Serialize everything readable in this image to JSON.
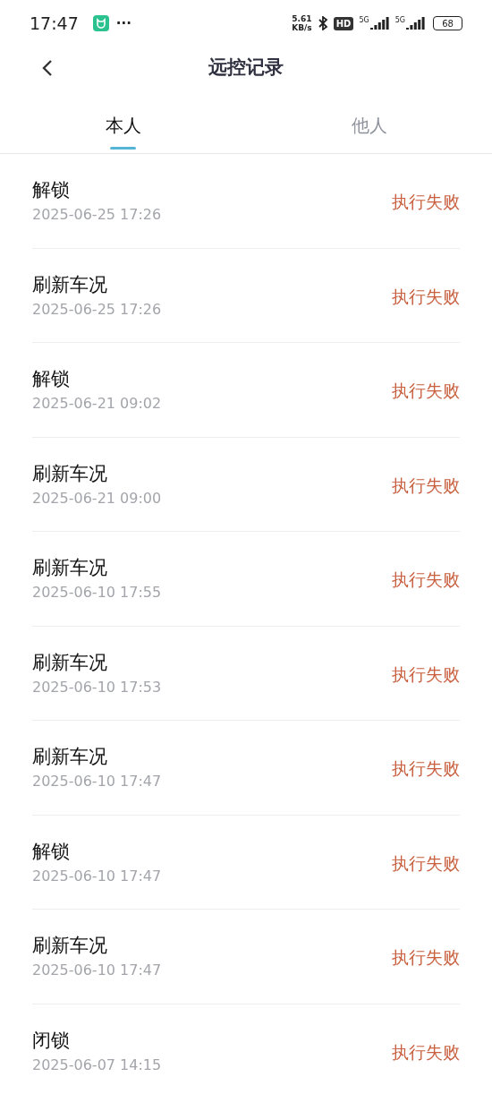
{
  "status_bar": {
    "time": "17:47",
    "more": "···",
    "net_speed": "5.61",
    "net_unit": "KB/s",
    "hd_badge": "HD",
    "signals": [
      "5G",
      "5G"
    ],
    "battery": "68"
  },
  "header": {
    "title": "远控记录"
  },
  "tabs": [
    {
      "label": "本人",
      "selected": true
    },
    {
      "label": "他人",
      "selected": false
    }
  ],
  "records": [
    {
      "action": "解锁",
      "time": "2025-06-25 17:26",
      "result": "执行失败"
    },
    {
      "action": "刷新车况",
      "time": "2025-06-25 17:26",
      "result": "执行失败"
    },
    {
      "action": "解锁",
      "time": "2025-06-21 09:02",
      "result": "执行失败"
    },
    {
      "action": "刷新车况",
      "time": "2025-06-21 09:00",
      "result": "执行失败"
    },
    {
      "action": "刷新车况",
      "time": "2025-06-10 17:55",
      "result": "执行失败"
    },
    {
      "action": "刷新车况",
      "time": "2025-06-10 17:53",
      "result": "执行失败"
    },
    {
      "action": "刷新车况",
      "time": "2025-06-10 17:47",
      "result": "执行失败"
    },
    {
      "action": "解锁",
      "time": "2025-06-10 17:47",
      "result": "执行失败"
    },
    {
      "action": "刷新车况",
      "time": "2025-06-10 17:47",
      "result": "执行失败"
    },
    {
      "action": "闭锁",
      "time": "2025-06-07 14:15",
      "result": "执行失败"
    }
  ]
}
